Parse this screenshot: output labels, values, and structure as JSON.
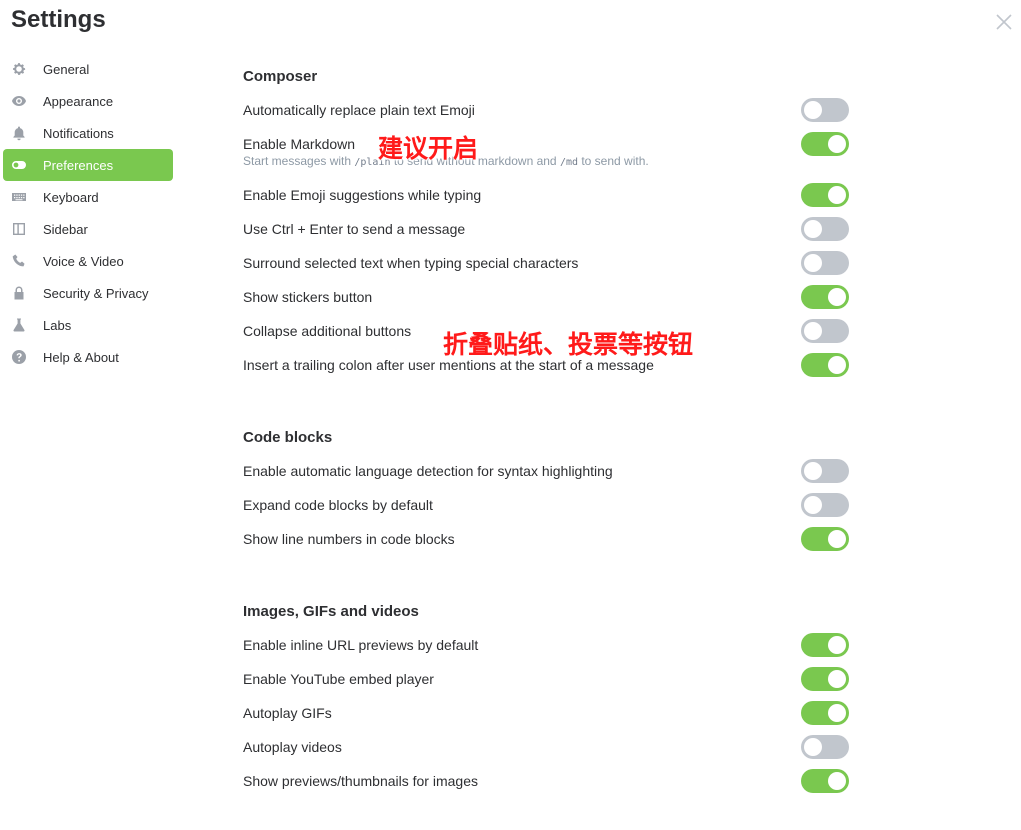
{
  "window": {
    "title": "Settings"
  },
  "sidebar": {
    "items": [
      {
        "label": "General",
        "icon": "gear-icon",
        "active": false
      },
      {
        "label": "Appearance",
        "icon": "eye-icon",
        "active": false
      },
      {
        "label": "Notifications",
        "icon": "bell-icon",
        "active": false
      },
      {
        "label": "Preferences",
        "icon": "toggle-icon",
        "active": true
      },
      {
        "label": "Keyboard",
        "icon": "keyboard-icon",
        "active": false
      },
      {
        "label": "Sidebar",
        "icon": "sidebar-icon",
        "active": false
      },
      {
        "label": "Voice & Video",
        "icon": "phone-icon",
        "active": false
      },
      {
        "label": "Security & Privacy",
        "icon": "lock-icon",
        "active": false
      },
      {
        "label": "Labs",
        "icon": "flask-icon",
        "active": false
      },
      {
        "label": "Help & About",
        "icon": "help-icon",
        "active": false
      }
    ]
  },
  "sections": {
    "composer": {
      "title": "Composer",
      "settings": [
        {
          "label": "Automatically replace plain text Emoji",
          "enabled": false
        },
        {
          "label": "Enable Markdown",
          "enabled": true,
          "description": {
            "before": "Start messages with ",
            "code1": "/plain",
            "middle": " to send without markdown and ",
            "code2": "/md",
            "after": " to send with."
          }
        },
        {
          "label": "Enable Emoji suggestions while typing",
          "enabled": true
        },
        {
          "label": "Use Ctrl + Enter to send a message",
          "enabled": false
        },
        {
          "label": "Surround selected text when typing special characters",
          "enabled": false
        },
        {
          "label": "Show stickers button",
          "enabled": true
        },
        {
          "label": "Collapse additional buttons",
          "enabled": false
        },
        {
          "label": "Insert a trailing colon after user mentions at the start of a message",
          "enabled": true
        }
      ]
    },
    "code_blocks": {
      "title": "Code blocks",
      "settings": [
        {
          "label": "Enable automatic language detection for syntax highlighting",
          "enabled": false
        },
        {
          "label": "Expand code blocks by default",
          "enabled": false
        },
        {
          "label": "Show line numbers in code blocks",
          "enabled": true
        }
      ]
    },
    "media": {
      "title": "Images, GIFs and videos",
      "settings": [
        {
          "label": "Enable inline URL previews by default",
          "enabled": true
        },
        {
          "label": "Enable YouTube embed player",
          "enabled": true
        },
        {
          "label": "Autoplay GIFs",
          "enabled": true
        },
        {
          "label": "Autoplay videos",
          "enabled": false
        },
        {
          "label": "Show previews/thumbnails for images",
          "enabled": true
        }
      ]
    }
  },
  "annotations": {
    "markdown_note": "建议开启",
    "collapse_note": "折叠贴纸、投票等按钮"
  },
  "colors": {
    "accent": "#7ac84f",
    "toggle_off": "#c1c6cd",
    "annotation": "#ff1a1a"
  }
}
